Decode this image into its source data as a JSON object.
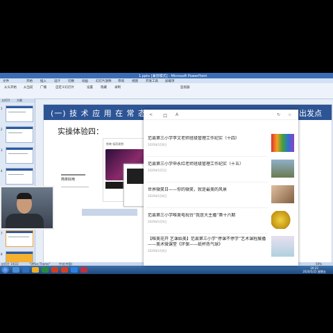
{
  "window": {
    "title": "1.pptx [兼容模式] - Microsoft PowerPoint"
  },
  "ribbon": {
    "tabs": [
      "文件",
      "开始",
      "插入",
      "设计",
      "切换",
      "动画",
      "幻灯片放映",
      "审阅",
      "视图",
      "开发工具",
      "加载项"
    ],
    "buttons": [
      "从头开始",
      "从当前",
      "广播",
      "自定义幻灯片",
      "设置",
      "隐藏",
      "录制",
      "监视器"
    ]
  },
  "sidebar": {
    "tabs": [
      "幻灯片",
      "大纲"
    ],
    "slide_numbers": [
      "1",
      "2",
      "3",
      "4",
      "5",
      "6",
      "7",
      "8"
    ]
  },
  "slide": {
    "banner_title": "(一) 技 术 应 用 在 常 态 工",
    "banner_right": "出发点",
    "subtitle": "实操体验四：",
    "app_header": "剪映 轻而易剪",
    "app_sub": "简单好用"
  },
  "status": {
    "slide_info": "幻灯片 19/22",
    "theme": "\"Office Theme\"",
    "lang": "中文(中国)",
    "zoom": "59%"
  },
  "taskbar": {
    "time": "20:22",
    "date": "2020/5/22 星期五"
  },
  "panel": {
    "toolbar": [
      "<",
      "口",
      "A",
      "↻",
      "☆",
      "…"
    ],
    "items": [
      {
        "title": "范县第三小学李文老师班级管理工作纪实（十四）",
        "date": "2020年5月8日"
      },
      {
        "title": "范县第三小学申永红老师班级管理工作纪实（十五）",
        "date": "2020年5月5日"
      },
      {
        "title": "世界微笑日——你的微笑，就是最美的风景",
        "date": "2020年5月8日"
      },
      {
        "title": "范县第三小学唯美电视台“我是大主播”第十六期",
        "date": "2020年5月9日"
      },
      {
        "title": "【唯美花开 艺课始美】范县第三小学“停课不停学”艺术课程展播——美术微课堂《环保——纸杯热气球》",
        "date": "2020年5月8日"
      }
    ]
  },
  "colors": {
    "banner": "#2d5596",
    "titlebar": "#3a6db5",
    "taskbar": "#1f4a80"
  }
}
